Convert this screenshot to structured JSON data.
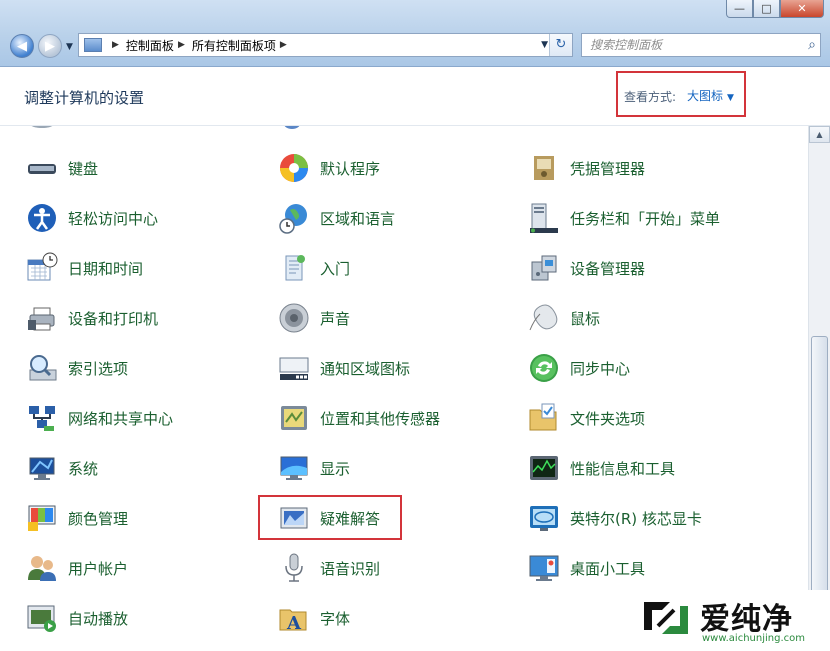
{
  "window": {
    "minimize_glyph": "—",
    "maximize_glyph": "□",
    "close_glyph": "✕"
  },
  "nav": {
    "back_glyph": "◀",
    "forward_glyph": "▶",
    "dropdown_glyph": "▼"
  },
  "address": {
    "segments": [
      "控制面板",
      "所有控制面板项"
    ],
    "separator_glyph": "▶",
    "dropdown_glyph": "▼",
    "refresh_glyph": "↻"
  },
  "search": {
    "placeholder": "搜索控制面板",
    "icon_glyph": "⌕"
  },
  "header": {
    "title": "调整计算机的设置",
    "view_label": "查看方式:",
    "view_value": "大图标",
    "view_caret": "▼"
  },
  "items": [
    {
      "label": "键盘",
      "icon": "keyboard-icon"
    },
    {
      "label": "默认程序",
      "icon": "default-programs-icon"
    },
    {
      "label": "凭据管理器",
      "icon": "credential-manager-icon"
    },
    {
      "label": "轻松访问中心",
      "icon": "ease-of-access-icon"
    },
    {
      "label": "区域和语言",
      "icon": "region-language-icon"
    },
    {
      "label": "任务栏和「开始」菜单",
      "icon": "taskbar-start-menu-icon"
    },
    {
      "label": "日期和时间",
      "icon": "date-time-icon"
    },
    {
      "label": "入门",
      "icon": "getting-started-icon"
    },
    {
      "label": "设备管理器",
      "icon": "device-manager-icon"
    },
    {
      "label": "设备和打印机",
      "icon": "devices-printers-icon"
    },
    {
      "label": "声音",
      "icon": "sound-icon"
    },
    {
      "label": "鼠标",
      "icon": "mouse-icon"
    },
    {
      "label": "索引选项",
      "icon": "indexing-options-icon"
    },
    {
      "label": "通知区域图标",
      "icon": "notification-area-icon"
    },
    {
      "label": "同步中心",
      "icon": "sync-center-icon"
    },
    {
      "label": "网络和共享中心",
      "icon": "network-sharing-icon"
    },
    {
      "label": "位置和其他传感器",
      "icon": "location-sensors-icon"
    },
    {
      "label": "文件夹选项",
      "icon": "folder-options-icon"
    },
    {
      "label": "系统",
      "icon": "system-icon"
    },
    {
      "label": "显示",
      "icon": "display-icon"
    },
    {
      "label": "性能信息和工具",
      "icon": "performance-icon"
    },
    {
      "label": "颜色管理",
      "icon": "color-management-icon"
    },
    {
      "label": "疑难解答",
      "icon": "troubleshooting-icon"
    },
    {
      "label": "英特尔(R) 核芯显卡",
      "icon": "intel-graphics-icon"
    },
    {
      "label": "用户帐户",
      "icon": "user-accounts-icon"
    },
    {
      "label": "语音识别",
      "icon": "speech-recognition-icon"
    },
    {
      "label": "桌面小工具",
      "icon": "desktop-gadgets-icon"
    },
    {
      "label": "自动播放",
      "icon": "autoplay-icon"
    },
    {
      "label": "字体",
      "icon": "fonts-icon"
    }
  ],
  "scrollbar": {
    "up_glyph": "▲",
    "down_glyph": "▼"
  },
  "watermark": {
    "text": "爱纯净",
    "url": "www.aichunjing.com"
  }
}
